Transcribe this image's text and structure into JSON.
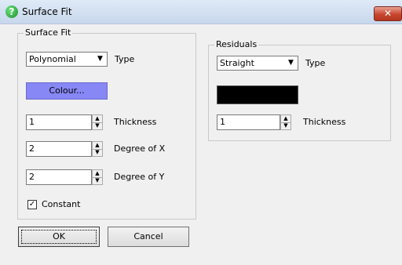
{
  "window": {
    "title": "Surface Fit",
    "close_symbol": "✕"
  },
  "surface_fit": {
    "group_title": "Surface Fit",
    "type_value": "Polynomial",
    "type_label": "Type",
    "colour_button": "Colour...",
    "colour_hex": "#8787f5",
    "thickness_value": "1",
    "thickness_label": "Thickness",
    "degree_x_value": "2",
    "degree_x_label": "Degree of X",
    "degree_y_value": "2",
    "degree_y_label": "Degree of Y",
    "constant_label": "Constant",
    "constant_checked": true
  },
  "residuals": {
    "group_title": "Residuals",
    "type_value": "Straight",
    "type_label": "Type",
    "colour_hex": "#000000",
    "thickness_value": "1",
    "thickness_label": "Thickness"
  },
  "buttons": {
    "ok": "OK",
    "cancel": "Cancel"
  }
}
